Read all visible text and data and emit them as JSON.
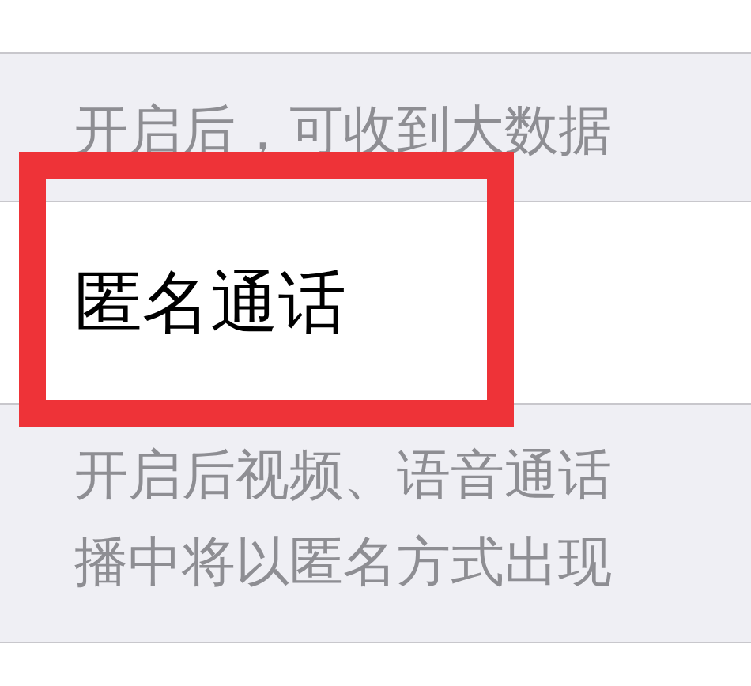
{
  "sections": [
    {
      "kind": "footer",
      "text": "开启后，可收到大数据"
    },
    {
      "kind": "cell",
      "label": "匿名通话",
      "highlighted": true
    },
    {
      "kind": "footer",
      "lines": [
        "开启后视频、语音通话",
        "播中将以匿名方式出现"
      ]
    }
  ]
}
